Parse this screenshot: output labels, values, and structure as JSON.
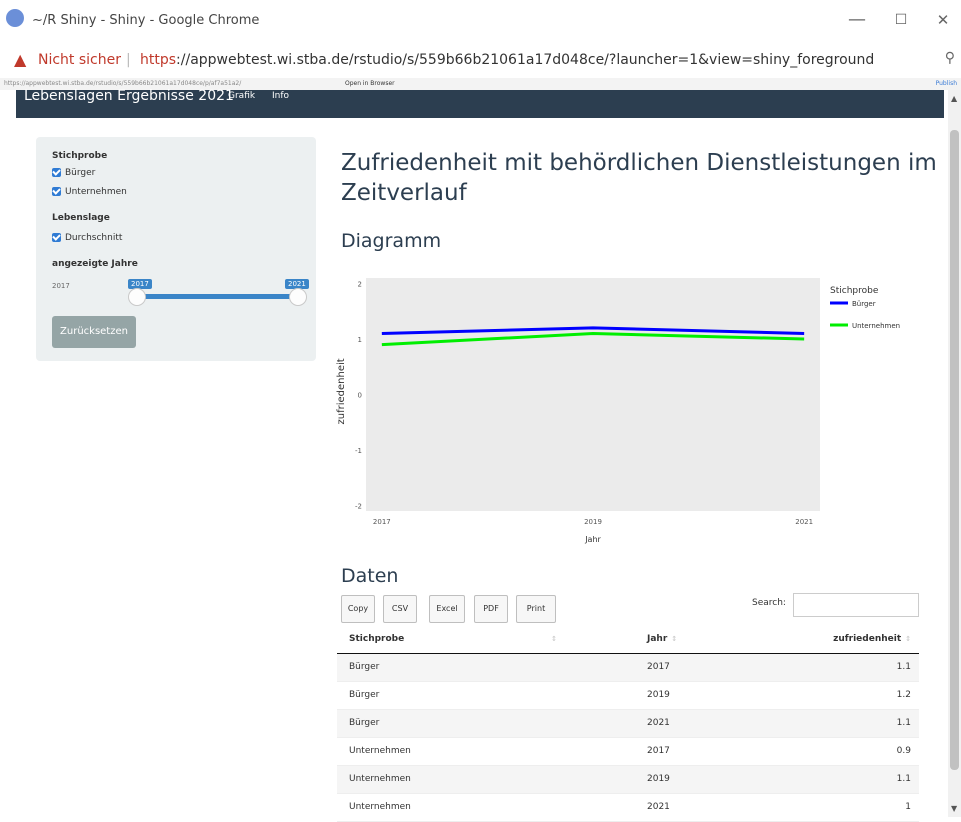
{
  "window": {
    "title": "~/R Shiny - Shiny - Google Chrome",
    "minimize": "—",
    "maximize": "☐",
    "close": "✕"
  },
  "address": {
    "not_secure": "Nicht sicher",
    "url_proto": "https",
    "url_rest": "://appwebtest.wi.stba.de/rstudio/s/559b66b21061a17d048ce/?launcher=1&view=shiny_foreground"
  },
  "rstudio": {
    "url": "https://appwebtest.wi.stba.de/rstudio/s/559b66b21061a17d048ce/p/af7a51a2/",
    "open_in_browser": "Open in Browser",
    "publish": "Publish"
  },
  "navbar": {
    "brand": "Lebenslagen Ergebnisse 2021",
    "items": [
      "Grafik",
      "Info"
    ]
  },
  "sidebar": {
    "stichprobe_label": "Stichprobe",
    "stichprobe_options": [
      "Bürger",
      "Unternehmen"
    ],
    "lebenslage_label": "Lebenslage",
    "lebenslage_options": [
      "Durchschnitt"
    ],
    "years_label": "angezeigte Jahre",
    "slider_min": "2017",
    "slider_from": "2017",
    "slider_to": "2021",
    "reset_label": "Zurücksetzen"
  },
  "main": {
    "title": "Zufriedenheit mit behördlichen Dienstleistungen im Zeitverlauf",
    "chart_heading": "Diagramm",
    "data_heading": "Daten"
  },
  "chart_data": {
    "type": "line",
    "x": [
      2017,
      2019,
      2021
    ],
    "series": [
      {
        "name": "Bürger",
        "values": [
          1.1,
          1.2,
          1.1
        ],
        "color": "#0000ff"
      },
      {
        "name": "Unternehmen",
        "values": [
          0.9,
          1.1,
          1.0
        ],
        "color": "#00ee00"
      }
    ],
    "xlabel": "Jahr",
    "ylabel": "zufriedenheit",
    "ylim": [
      -2,
      2
    ],
    "yticks": [
      -2,
      -1,
      0,
      1,
      2
    ],
    "xticks": [
      2017,
      2019,
      2021
    ],
    "legend_title": "Stichprobe",
    "legend_position": "right",
    "panel_bg": "#ebebeb",
    "grid": false
  },
  "datatable": {
    "buttons": [
      "Copy",
      "CSV",
      "Excel",
      "PDF",
      "Print"
    ],
    "search_label": "Search:",
    "search_value": "",
    "columns": [
      "Stichprobe",
      "Jahr",
      "zufriedenheit"
    ],
    "rows": [
      [
        "Bürger",
        "2017",
        "1.1"
      ],
      [
        "Bürger",
        "2019",
        "1.2"
      ],
      [
        "Bürger",
        "2021",
        "1.1"
      ],
      [
        "Unternehmen",
        "2017",
        "0.9"
      ],
      [
        "Unternehmen",
        "2019",
        "1.1"
      ],
      [
        "Unternehmen",
        "2021",
        "1"
      ]
    ]
  }
}
